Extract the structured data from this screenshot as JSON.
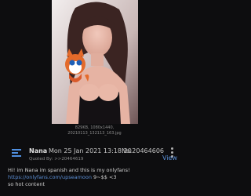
{
  "file_info": {
    "size_dims": "829KB, 1080x1440,",
    "filename": "20210113_132113_163.jpg"
  },
  "post": {
    "name": "Nana",
    "date": "Mon 25 Jan 2021 13:18:20",
    "number": "No.20464606",
    "quoted_by_label": "Quoted By:",
    "quoted_by_link": ">>20464619",
    "view_label": "View",
    "body_line1": "Hi! im Nana im spanish and this is my onlyfans!",
    "body_link": "https://onlyfans.com/upseamoon",
    "body_link_suffix": " 9~$$ <3",
    "body_line3": "so hot content"
  },
  "colors": {
    "background": "#0d0d0f",
    "link": "#5b8fd6",
    "icon_accent": "#4f8fe0"
  }
}
